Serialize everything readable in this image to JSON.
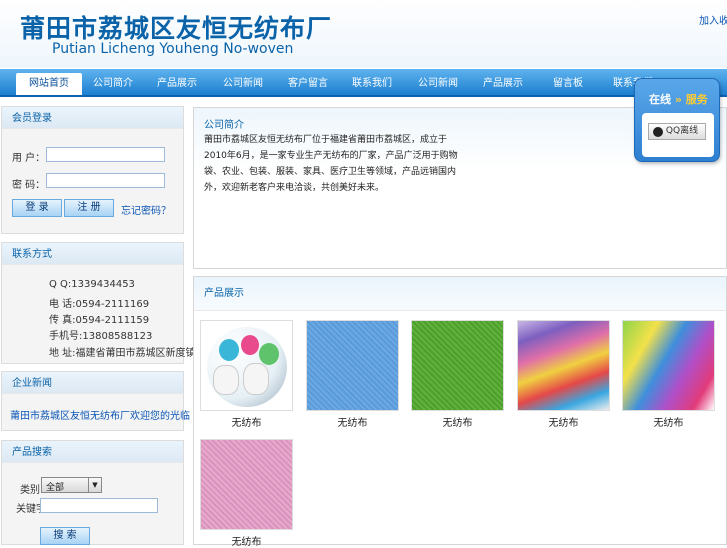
{
  "header": {
    "title_cn": "莆田市荔城区友恒无纺布厂",
    "title_en": "Putian Licheng Youheng No-woven",
    "top_link": "加入收藏"
  },
  "nav": {
    "items": [
      "网站首页",
      "公司简介",
      "产品展示",
      "公司新闻",
      "客户留言",
      "联系我们",
      "公司新闻",
      "产品展示",
      "留言板",
      "联系我们"
    ]
  },
  "login": {
    "title": "会员登录",
    "user_label": "用 户：",
    "pass_label": "密 码：",
    "user_value": "",
    "pass_value": "",
    "login_btn": "登 录",
    "reg_btn": "注 册",
    "forgot_link": "忘记密码？"
  },
  "contact": {
    "title": "联系方式",
    "lines": [
      "Q Q:1339434453",
      "电 话:0594-2111169",
      "传 真:0594-2111159",
      "手机号:13808588123",
      "地 址:福建省莆田市荔城区新度镇"
    ]
  },
  "news": {
    "title": "企业新闻",
    "items": [
      "莆田市荔城区友恒无纺布厂欢迎您的光临"
    ]
  },
  "search": {
    "title": "产品搜索",
    "type_label": "类别：",
    "type_value": "全部",
    "keyword_label": "关键字：",
    "keyword_value": "",
    "search_btn": "搜 索"
  },
  "about": {
    "title": "公司简介",
    "text": "莆田市荔城区友恒无纺布厂位于福建省莆田市荔城区，成立于2010年6月，是一家专业生产无纺布的厂家，产品广泛用于购物袋、农业、包装、服装、家具、医疗卫生等领域，产品远销国内外，欢迎新老客户来电洽谈，共创美好未来。"
  },
  "products": {
    "title": "产品展示",
    "items": [
      {
        "name": "无纺布",
        "icon": "fabric-rolls-image"
      },
      {
        "name": "无纺布",
        "icon": "blue-fabric-image"
      },
      {
        "name": "无纺布",
        "icon": "green-fabric-image"
      },
      {
        "name": "无纺布",
        "icon": "colored-sheets-image"
      },
      {
        "name": "无纺布",
        "icon": "folded-fabric-image"
      },
      {
        "name": "无纺布",
        "icon": "pink-fabric-image"
      }
    ]
  },
  "qq": {
    "label_a": "在线",
    "label_b": "服务",
    "btn": "QQ离线"
  },
  "colors": {
    "brand": "#0a63a8",
    "nav_bg": "#1c7fd0",
    "panel_bg": "#f4f4f4"
  }
}
